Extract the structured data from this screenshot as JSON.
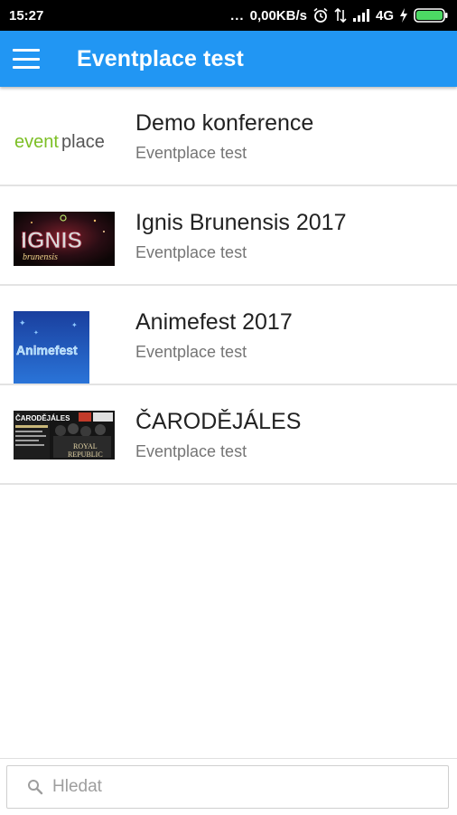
{
  "status_bar": {
    "time": "15:27",
    "dots": "...",
    "network_speed": "0,00KB/s",
    "network_type": "4G",
    "icons": [
      "alarm-icon",
      "data-transfer-icon",
      "signal-icon",
      "charging-icon",
      "battery-icon"
    ]
  },
  "app_bar": {
    "title": "Eventplace test",
    "menu_icon": "hamburger-menu-icon",
    "color": "#2196F3"
  },
  "events": [
    {
      "title": "Demo konference",
      "subtitle": "Eventplace test",
      "thumbnail_logo": {
        "part1": "event",
        "part2": "place"
      }
    },
    {
      "title": "Ignis Brunensis 2017",
      "subtitle": "Eventplace test",
      "thumbnail_logo": {
        "part1": "IGNIS",
        "part2": "brunensis"
      }
    },
    {
      "title": "Animefest 2017",
      "subtitle": "Eventplace test",
      "thumbnail_logo": {
        "part1": "Animefest"
      }
    },
    {
      "title": "ČARODĚJÁLES",
      "subtitle": "Eventplace test",
      "thumbnail_logo": {
        "part1": "ČARODĚJÁLES",
        "part2": "ROYAL",
        "part3": "REPUBLIC"
      }
    }
  ],
  "search": {
    "placeholder": "Hledat",
    "value": "",
    "icon": "search-icon"
  }
}
